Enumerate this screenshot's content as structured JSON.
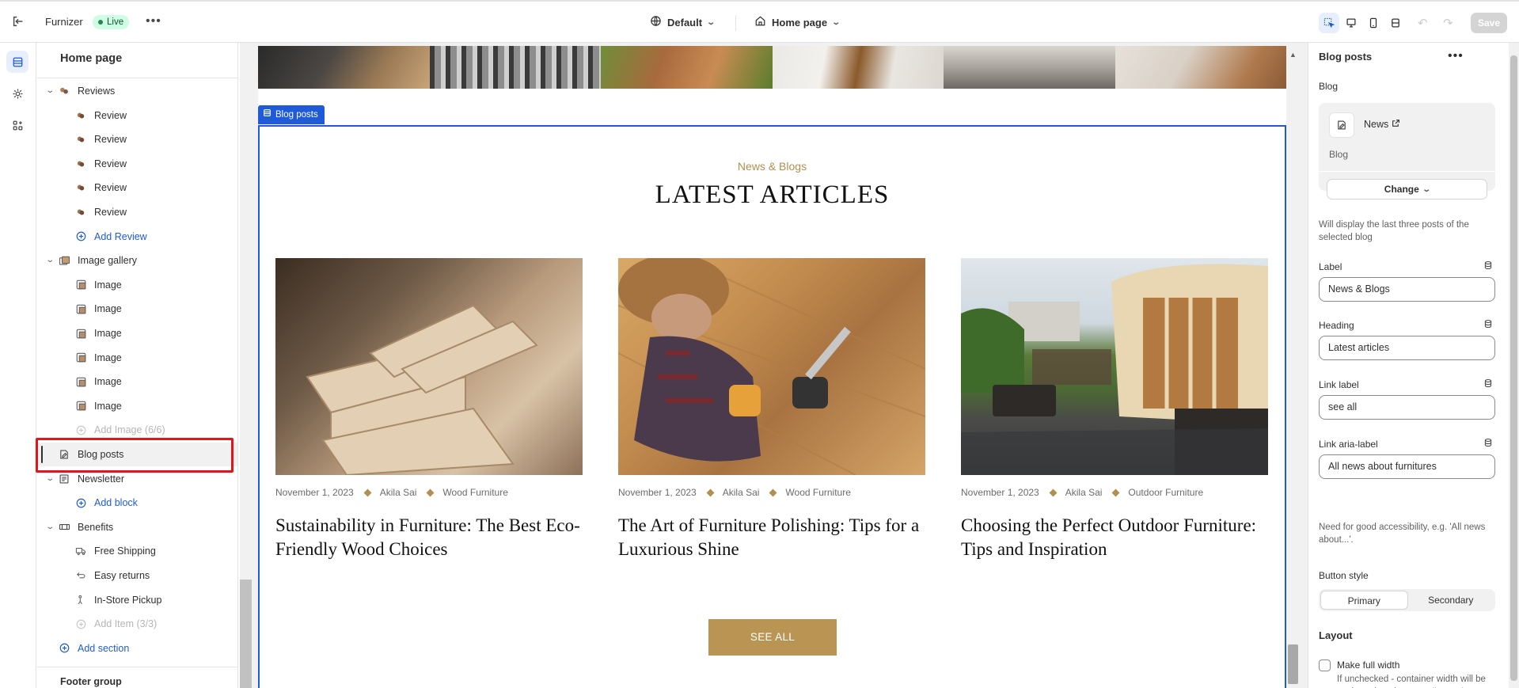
{
  "topbar": {
    "store_name": "Furnizer",
    "status_badge": "Live",
    "theme": "Default",
    "page": "Home page",
    "save_label": "Save"
  },
  "tree": {
    "header": "Home page",
    "rows": [
      {
        "label": "Reviews",
        "level": 0,
        "icon": "reviews-icon"
      },
      {
        "label": "Review",
        "level": 1,
        "icon": "review-icon"
      },
      {
        "label": "Review",
        "level": 1,
        "icon": "review-icon"
      },
      {
        "label": "Review",
        "level": 1,
        "icon": "review-icon"
      },
      {
        "label": "Review",
        "level": 1,
        "icon": "review-icon"
      },
      {
        "label": "Review",
        "level": 1,
        "icon": "review-icon"
      },
      {
        "label": "Add Review",
        "level": 1,
        "icon": "plus-circle-icon",
        "kind": "link"
      },
      {
        "label": "Image gallery",
        "level": 0,
        "icon": "image-gallery-icon"
      },
      {
        "label": "Image",
        "level": 1,
        "icon": "image-icon"
      },
      {
        "label": "Image",
        "level": 1,
        "icon": "image-icon"
      },
      {
        "label": "Image",
        "level": 1,
        "icon": "image-icon"
      },
      {
        "label": "Image",
        "level": 1,
        "icon": "image-icon"
      },
      {
        "label": "Image",
        "level": 1,
        "icon": "image-icon"
      },
      {
        "label": "Image",
        "level": 1,
        "icon": "image-icon"
      },
      {
        "label": "Add Image (6/6)",
        "level": 1,
        "icon": "plus-circle-icon",
        "kind": "muted"
      },
      {
        "label": "Blog posts",
        "level": 0,
        "icon": "blog-icon",
        "kind": "selected"
      },
      {
        "label": "Newsletter",
        "level": 0,
        "icon": "newsletter-icon"
      },
      {
        "label": "Add block",
        "level": 1,
        "icon": "plus-circle-icon",
        "kind": "link"
      },
      {
        "label": "Benefits",
        "level": 0,
        "icon": "benefits-icon"
      },
      {
        "label": "Free Shipping",
        "level": 1,
        "icon": "truck-icon"
      },
      {
        "label": "Easy returns",
        "level": 1,
        "icon": "returns-icon"
      },
      {
        "label": "In-Store Pickup",
        "level": 1,
        "icon": "pickup-icon"
      },
      {
        "label": "Add Item (3/3)",
        "level": 1,
        "icon": "plus-circle-icon",
        "kind": "muted"
      },
      {
        "label": "Add section",
        "level": 0,
        "icon": "plus-circle-icon",
        "kind": "link"
      }
    ],
    "footer_group": "Footer group"
  },
  "preview": {
    "section_tag": "Blog posts",
    "subheading": "News & Blogs",
    "heading": "LATEST ARTICLES",
    "see_all": "SEE ALL",
    "articles": [
      {
        "date": "November 1, 2023",
        "author": "Akila Sai",
        "category": "Wood Furniture",
        "title": "Sustainability in Furniture: The Best Eco-Friendly Wood Choices"
      },
      {
        "date": "November 1, 2023",
        "author": "Akila Sai",
        "category": "Wood Furniture",
        "title": "The Art of Furniture Polishing: Tips for a Luxurious Shine"
      },
      {
        "date": "November 1, 2023",
        "author": "Akila Sai",
        "category": "Outdoor Furniture",
        "title": "Choosing the Perfect Outdoor Furniture: Tips and Inspiration"
      }
    ]
  },
  "settings": {
    "title": "Blog posts",
    "blog_label": "Blog",
    "blog_name": "News",
    "blog_type": "Blog",
    "change_label": "Change",
    "blog_help": "Will display the last three posts of the selected blog",
    "fields": [
      {
        "label": "Label",
        "value": "News & Blogs"
      },
      {
        "label": "Heading",
        "value": "Latest articles"
      },
      {
        "label": "Link label",
        "value": "see all"
      },
      {
        "label": "Link aria-label",
        "value": "All news about furnitures"
      }
    ],
    "aria_help": "Need for good accessibility, e.g. 'All news about...'.",
    "button_style_label": "Button style",
    "button_styles": [
      "Primary",
      "Secondary"
    ],
    "layout_heading": "Layout",
    "full_width_label": "Make full width",
    "full_width_help": "If unchecked - container width will be set based on the group 'Layout' settings in the Theme settings."
  }
}
